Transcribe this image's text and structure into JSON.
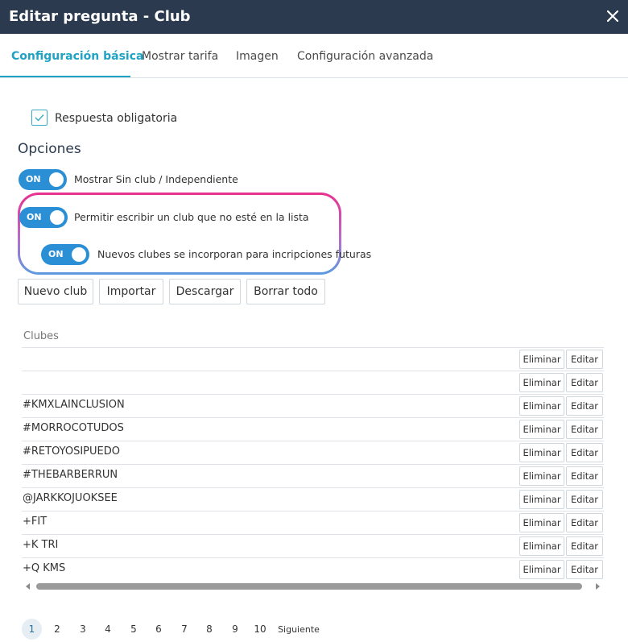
{
  "dialog": {
    "title": "Editar pregunta - Club"
  },
  "tabs": [
    {
      "label": "Configuración básica",
      "active": true
    },
    {
      "label": "Mostrar tarifa",
      "active": false
    },
    {
      "label": "Imagen",
      "active": false
    },
    {
      "label": "Configuración avanzada",
      "active": false
    }
  ],
  "required": {
    "label": "Respuesta obligatoria",
    "checked": true
  },
  "options": {
    "title": "Opciones",
    "toggles": [
      {
        "state": "ON",
        "label": "Mostrar Sin club / Independiente"
      },
      {
        "state": "ON",
        "label": "Permitir escribir un club que no esté en la lista"
      },
      {
        "state": "ON",
        "label": "Nuevos clubes se incorporan para incripciones futuras"
      }
    ]
  },
  "actions": {
    "new_club": "Nuevo club",
    "import": "Importar",
    "download": "Descargar",
    "delete_all": "Borrar todo"
  },
  "table": {
    "header": "Clubes",
    "delete_label": "Eliminar",
    "edit_label": "Editar",
    "rows": [
      "",
      "",
      "#KMXLAINCLUSION",
      "#MORROCOTUDOS",
      "#RETOYOSIPUEDO",
      "#THEBARBERRUN",
      "@JARKKOJUOKSEE",
      "+FIT",
      "+K TRI",
      "+Q KMS"
    ]
  },
  "pagination": {
    "pages": [
      "1",
      "2",
      "3",
      "4",
      "5",
      "6",
      "7",
      "8",
      "9",
      "10"
    ],
    "current": "1",
    "next": "Siguiente"
  },
  "colors": {
    "header_bg": "#2b3a4f",
    "accent": "#1fa2c4",
    "toggle_on": "#2b8fd6"
  }
}
